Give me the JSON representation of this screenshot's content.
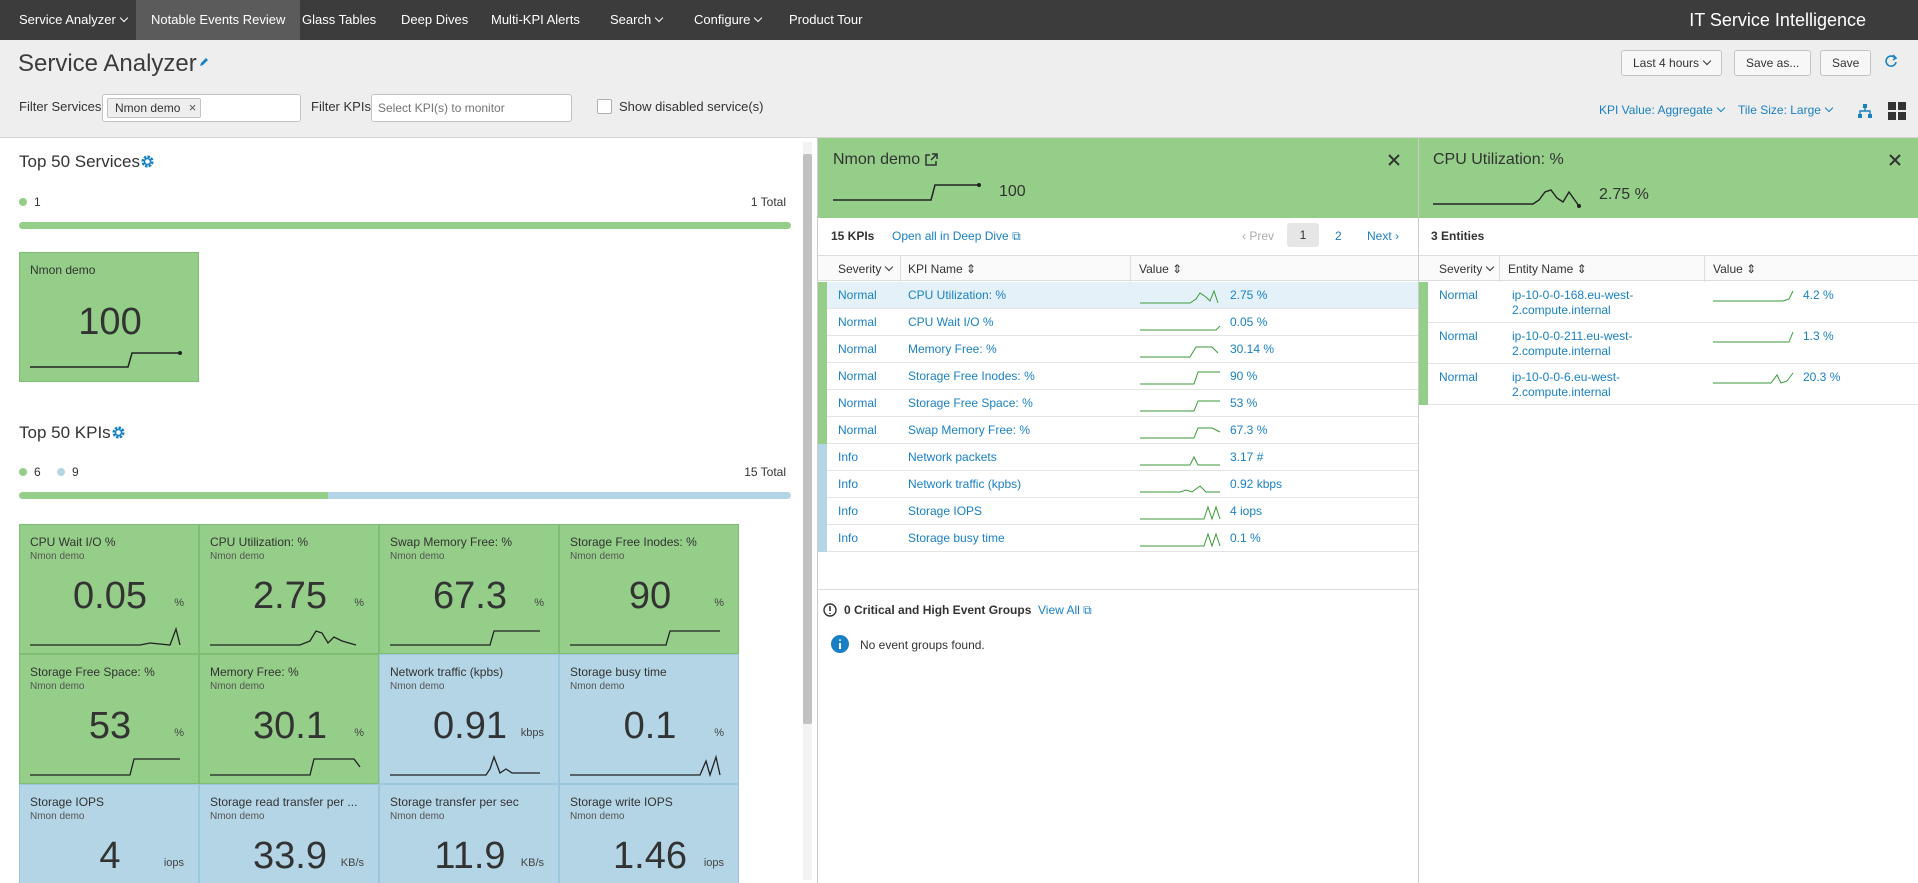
{
  "nav": {
    "items": [
      {
        "label": "Service Analyzer",
        "dropdown": true
      },
      {
        "label": "Notable Events Review",
        "dropdown": false
      },
      {
        "label": "Glass Tables",
        "dropdown": false
      },
      {
        "label": "Deep Dives",
        "dropdown": false
      },
      {
        "label": "Multi-KPI Alerts",
        "dropdown": false
      },
      {
        "label": "Search",
        "dropdown": true
      },
      {
        "label": "Configure",
        "dropdown": true
      },
      {
        "label": "Product Tour",
        "dropdown": false
      }
    ],
    "brand": "IT Service Intelligence"
  },
  "header": {
    "title": "Service Analyzer",
    "time_range": "Last 4 hours",
    "save_as": "Save as...",
    "save": "Save"
  },
  "filters": {
    "services_label": "Filter Services",
    "service_chip": "Nmon demo",
    "kpis_label": "Filter KPIs",
    "kpis_placeholder": "Select KPI(s) to monitor",
    "show_disabled": "Show disabled service(s)",
    "kpi_value": "KPI Value: Aggregate",
    "tile_size": "Tile Size: Large"
  },
  "services": {
    "title": "Top 50 Services",
    "legend_count": "1",
    "total": "1 Total",
    "tiles": [
      {
        "name": "Nmon demo",
        "value": "100"
      }
    ]
  },
  "kpis": {
    "title": "Top 50 KPIs",
    "legend_normal": "6",
    "legend_info": "9",
    "total": "15 Total",
    "normal_fraction": 0.4,
    "tiles": [
      {
        "name": "CPU Wait I/O %",
        "service": "Nmon demo",
        "value": "0.05",
        "unit": "%",
        "status": "normal"
      },
      {
        "name": "CPU Utilization: %",
        "service": "Nmon demo",
        "value": "2.75",
        "unit": "%",
        "status": "normal"
      },
      {
        "name": "Swap Memory Free: %",
        "service": "Nmon demo",
        "value": "67.3",
        "unit": "%",
        "status": "normal"
      },
      {
        "name": "Storage Free Inodes: %",
        "service": "Nmon demo",
        "value": "90",
        "unit": "%",
        "status": "normal"
      },
      {
        "name": "Storage Free Space: %",
        "service": "Nmon demo",
        "value": "53",
        "unit": "%",
        "status": "normal"
      },
      {
        "name": "Memory Free: %",
        "service": "Nmon demo",
        "value": "30.1",
        "unit": "%",
        "status": "normal"
      },
      {
        "name": "Network traffic (kpbs)",
        "service": "Nmon demo",
        "value": "0.91",
        "unit": "kbps",
        "status": "info"
      },
      {
        "name": "Storage busy time",
        "service": "Nmon demo",
        "value": "0.1",
        "unit": "%",
        "status": "info"
      },
      {
        "name": "Storage IOPS",
        "service": "Nmon demo",
        "value": "4",
        "unit": "iops",
        "status": "info"
      },
      {
        "name": "Storage read transfer per ...",
        "service": "Nmon demo",
        "value": "33.9",
        "unit": "KB/s",
        "status": "info"
      },
      {
        "name": "Storage transfer per sec",
        "service": "Nmon demo",
        "value": "11.9",
        "unit": "KB/s",
        "status": "info"
      },
      {
        "name": "Storage write IOPS",
        "service": "Nmon demo",
        "value": "1.46",
        "unit": "iops",
        "status": "info"
      }
    ]
  },
  "service_panel": {
    "title": "Nmon demo",
    "value": "100",
    "kpi_count": "15 KPIs",
    "open_deep_dive": "Open all in Deep Dive",
    "prev": "Prev",
    "page1": "1",
    "page2": "2",
    "next": "Next",
    "col_severity": "Severity",
    "col_kpi": "KPI Name",
    "col_value": "Value",
    "rows": [
      {
        "severity": "Normal",
        "kpi": "CPU Utilization: %",
        "value": "2.75 %"
      },
      {
        "severity": "Normal",
        "kpi": "CPU Wait I/O %",
        "value": "0.05 %"
      },
      {
        "severity": "Normal",
        "kpi": "Memory Free: %",
        "value": "30.14 %"
      },
      {
        "severity": "Normal",
        "kpi": "Storage Free Inodes: %",
        "value": "90 %"
      },
      {
        "severity": "Normal",
        "kpi": "Storage Free Space: %",
        "value": "53 %"
      },
      {
        "severity": "Normal",
        "kpi": "Swap Memory Free: %",
        "value": "67.3 %"
      },
      {
        "severity": "Info",
        "kpi": "Network packets",
        "value": "3.17 #"
      },
      {
        "severity": "Info",
        "kpi": "Network traffic (kpbs)",
        "value": "0.92 kbps"
      },
      {
        "severity": "Info",
        "kpi": "Storage IOPS",
        "value": "4 iops"
      },
      {
        "severity": "Info",
        "kpi": "Storage busy time",
        "value": "0.1 %"
      }
    ],
    "events_title": "0 Critical and High Event Groups",
    "view_all": "View All",
    "no_events": "No event groups found."
  },
  "kpi_panel": {
    "title": "CPU Utilization: %",
    "value": "2.75 %",
    "entity_count": "3 Entities",
    "col_severity": "Severity",
    "col_entity": "Entity Name",
    "col_value": "Value",
    "rows": [
      {
        "severity": "Normal",
        "entity_line1": "ip-10-0-0-168.eu-west-",
        "entity_line2": "2.compute.internal",
        "value": "4.2 %"
      },
      {
        "severity": "Normal",
        "entity_line1": "ip-10-0-0-211.eu-west-",
        "entity_line2": "2.compute.internal",
        "value": "1.3 %"
      },
      {
        "severity": "Normal",
        "entity_line1": "ip-10-0-0-6.eu-west-",
        "entity_line2": "2.compute.internal",
        "value": "20.3 %"
      }
    ]
  },
  "colors": {
    "normal": "#94ce88",
    "info": "#b3d5e6",
    "link": "#1a80c4",
    "nav_bg": "#3c3c3c"
  }
}
